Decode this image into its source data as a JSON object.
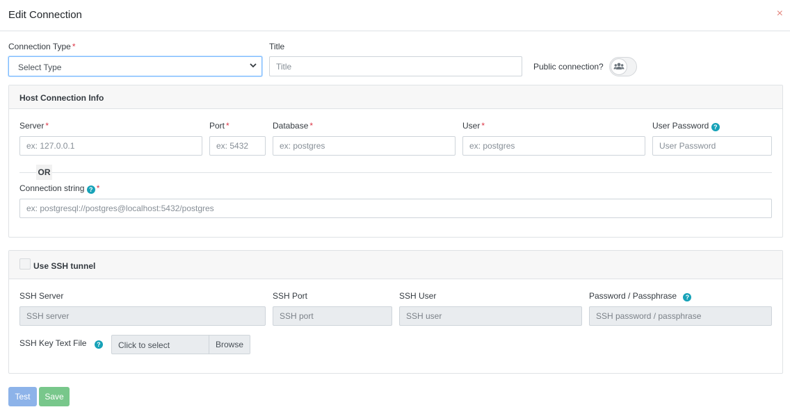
{
  "dialog": {
    "title": "Edit Connection",
    "close_glyph": "×"
  },
  "general": {
    "connection_type_label": "Connection Type",
    "connection_type_value": "Select Type",
    "title_label": "Title",
    "title_placeholder": "Title",
    "public_label": "Public connection?",
    "public_enabled": false,
    "required_mark": "*"
  },
  "host": {
    "header": "Host Connection Info",
    "server_label": "Server",
    "server_placeholder": "ex: 127.0.0.1",
    "port_label": "Port",
    "port_placeholder": "ex: 5432",
    "database_label": "Database",
    "database_placeholder": "ex: postgres",
    "user_label": "User",
    "user_placeholder": "ex: postgres",
    "password_label": "User Password",
    "password_placeholder": "User Password",
    "or_text": "OR",
    "conn_string_label": "Connection string",
    "conn_string_placeholder": "ex: postgresql://postgres@localhost:5432/postgres",
    "help_glyph": "?"
  },
  "ssh": {
    "header": "Use SSH tunnel",
    "enabled": false,
    "server_label": "SSH Server",
    "server_placeholder": "SSH server",
    "port_label": "SSH Port",
    "port_placeholder": "SSH port",
    "user_label": "SSH User",
    "user_placeholder": "SSH user",
    "password_label": "Password / Passphrase",
    "password_placeholder": "SSH password / passphrase",
    "key_file_label": "SSH Key Text File",
    "key_file_text": "Click to select",
    "browse_label": "Browse"
  },
  "actions": {
    "test_label": "Test",
    "save_label": "Save"
  },
  "colors": {
    "accent_blue": "#8db3e9",
    "save_green": "#78c78b",
    "required_red": "#dc3545",
    "help_teal": "#17a2b8"
  }
}
